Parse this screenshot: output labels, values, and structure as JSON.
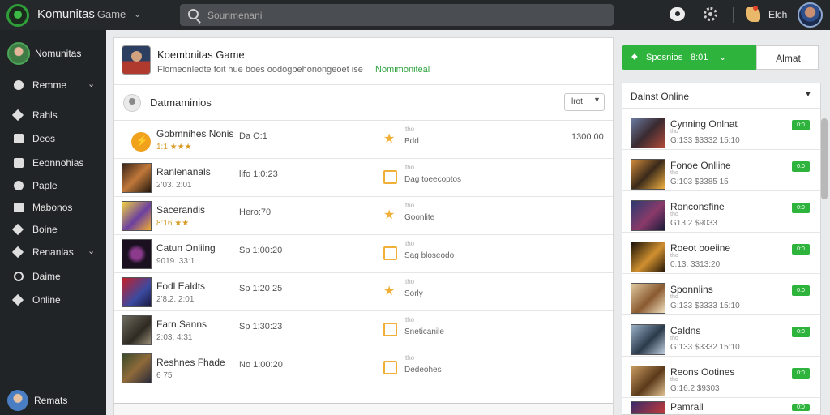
{
  "topbar": {
    "app_title": "Komunitas",
    "app_subtitle": "Game",
    "search_placeholder": "Sounmenani",
    "user_name": "Elch"
  },
  "sidebar": {
    "profile_name": "Nomunitas",
    "items": [
      {
        "label": "Remme",
        "icon": "circle-icon",
        "has_chevron": true
      },
      {
        "label": "Rahls",
        "icon": "rocket-icon"
      },
      {
        "label": "Deos",
        "icon": "square-icon"
      },
      {
        "label": "Eeonnohias",
        "icon": "grid-icon"
      },
      {
        "label": "Paple",
        "icon": "gear-icon"
      },
      {
        "label": "Mabonos",
        "icon": "square-icon"
      },
      {
        "label": "Boine",
        "icon": "rocket-icon"
      },
      {
        "label": "Renanlas",
        "icon": "rocket-icon",
        "has_chevron": true
      },
      {
        "label": "Daime",
        "icon": "ring-icon"
      },
      {
        "label": "Online",
        "icon": "link-icon"
      }
    ],
    "bottom_name": "Remats"
  },
  "main": {
    "header_title": "Koembnitas Game",
    "header_sub": "Flomeonledte foit hue boes oodogbehonongeoet ise",
    "header_link": "Nomimoniteal",
    "section_title": "Datmaminios",
    "sort_value": "lrot",
    "rows": [
      {
        "name": "Gobmnihes Nonis",
        "meta": "1:1 ★★★",
        "time": "Da O:1",
        "desc": "Bdd",
        "tag": "tho",
        "end": "1300 00",
        "action": "star",
        "thumb": "bolt"
      },
      {
        "name": "Ranlenanals",
        "meta": "2'03. 2:01",
        "time": "lifo 1:0:23",
        "desc": "Dag toeecoptos",
        "tag": "tho",
        "end": "",
        "action": "box",
        "thumb": "warrior"
      },
      {
        "name": "Sacerandis",
        "meta": "8:16 ★★",
        "time": "Hero:70",
        "desc": "Goonlite",
        "tag": "tho",
        "end": "",
        "action": "star",
        "thumb": "yellow"
      },
      {
        "name": "Catun Onliing",
        "meta": "9019. 33:1",
        "time": "Sp 1:00:20",
        "desc": "Sag bloseodo",
        "tag": "tho",
        "end": "",
        "action": "box",
        "thumb": "dark"
      },
      {
        "name": "Fodl Ealdts",
        "meta": "2'8.2. 2:01",
        "time": "Sp 1:20 25",
        "desc": "Sorly",
        "tag": "tho",
        "end": "",
        "action": "star",
        "thumb": "red"
      },
      {
        "name": "Farn Sanns",
        "meta": "2:03. 4:31",
        "time": "Sp 1:30:23",
        "desc": "Sneticanile",
        "tag": "tho",
        "end": "",
        "action": "box",
        "thumb": "knight"
      },
      {
        "name": "Reshnes Fhade",
        "meta": "6 75",
        "time": "No 1:00:20",
        "desc": "Dedeohes",
        "tag": "tho",
        "end": "",
        "action": "box",
        "thumb": "battle"
      }
    ]
  },
  "right": {
    "spectate_label": "Sposnios",
    "spectate_count": "8:01",
    "about_label": "Almat",
    "panel_title": "Dalnst Online",
    "items": [
      {
        "name": "Cynning Onlnat",
        "tag": "tho",
        "meta": "G:133 $3332 15:10",
        "badge": "0:0"
      },
      {
        "name": "Fonoe Onlline",
        "tag": "tho",
        "meta": "G:103 $3385 15",
        "badge": "0:0"
      },
      {
        "name": "Ronconsfine",
        "tag": "tho",
        "meta": "G13.2 $9033",
        "badge": "0:0"
      },
      {
        "name": "Roeot ooeiine",
        "tag": "tho",
        "meta": "0.13. 3313:20",
        "badge": "0:0"
      },
      {
        "name": "Sponnlins",
        "tag": "tho",
        "meta": "G:133 $3333 15:10",
        "badge": "0:0"
      },
      {
        "name": "Caldns",
        "tag": "tho",
        "meta": "G:133 $3332 15:10",
        "badge": "0:0"
      },
      {
        "name": "Reons Ootines",
        "tag": "tho",
        "meta": "G:16.2 $9303",
        "badge": "0:0"
      },
      {
        "name": "Pamrall",
        "tag": "",
        "meta": "",
        "badge": "0:0"
      }
    ]
  },
  "colors": {
    "accent": "#2eb43c",
    "star": "#f0b038",
    "topbar": "#25282b",
    "sidebar": "#212426"
  }
}
